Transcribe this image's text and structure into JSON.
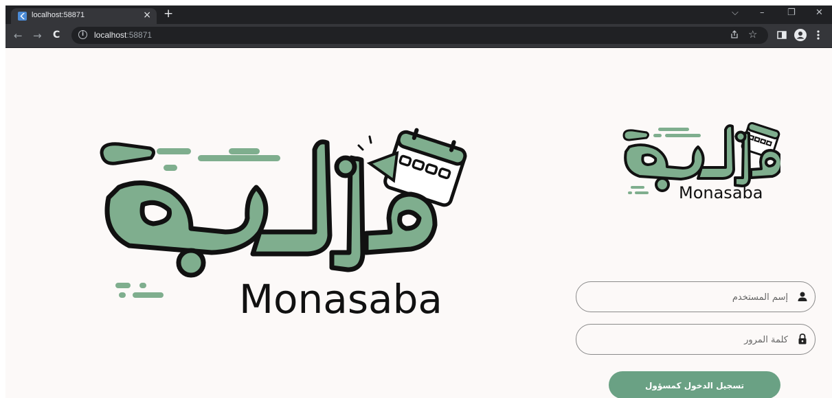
{
  "browser": {
    "tab_title": "localhost:58871",
    "tab_close_glyph": "×",
    "new_tab_glyph": "+",
    "window_controls": {
      "tab_search": "⌵",
      "minimize": "–",
      "restore": "❐",
      "close": "✕"
    },
    "nav": {
      "back": "←",
      "forward": "→",
      "reload": "C"
    },
    "url_host": "localhost",
    "url_port": ":58871",
    "icons": [
      "info-icon",
      "share-icon",
      "bookmark-star-icon",
      "side-panel-icon",
      "profile-icon",
      "menu-kebab-icon"
    ]
  },
  "brand": {
    "arabic_logo_text": "مناسبة",
    "latin_name": "Monasaba",
    "color": "#7fae8e",
    "outline_color": "#111111"
  },
  "form": {
    "username_placeholder": "إسم المستخدم",
    "password_placeholder": "كلمة المرور",
    "login_label": "تسجيل الدخول كمسؤول",
    "button_color": "#6aa184"
  }
}
